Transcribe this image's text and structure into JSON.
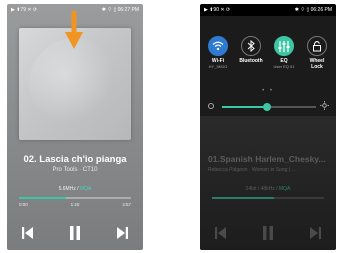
{
  "left_screen": {
    "status": {
      "left": "▶ ⬆79 ✕ ⟳",
      "right": "✱ ⌔ ▯ 06:27 PM"
    },
    "track_title": "02. Lascia ch'io pianga",
    "track_subtitle": "Pro Tools · CT10",
    "format": "5.6MHz / ",
    "format_highlight": "MQA",
    "elapsed": "0:00",
    "mid": "1:20",
    "total": "3:57",
    "progress": 0.42,
    "icons": {
      "arrow": "down-arrow-icon",
      "prev": "skip-previous-icon",
      "play": "pause-icon",
      "next": "skip-next-icon"
    },
    "accent": "#3dc6a4",
    "arrow_color": "#f29422"
  },
  "right_screen": {
    "status": {
      "left": "▶ ⬆90 ✕ ⟳",
      "right": "✱ ⌔ ▯ 06:26 PM"
    },
    "quick_settings": [
      {
        "label": "Wi-Fi",
        "sub": "HY_5KDG",
        "active": true,
        "icon": "wifi-icon",
        "color": "#2f7ad1"
      },
      {
        "label": "Bluetooth",
        "sub": "",
        "active": false,
        "icon": "bluetooth-icon"
      },
      {
        "label": "EQ",
        "sub": "User EQ 01",
        "active": true,
        "icon": "equalizer-icon",
        "color": "#3dc6a4"
      },
      {
        "label": "Wheel Lock",
        "sub": "",
        "active": false,
        "icon": "lock-icon"
      }
    ],
    "page_dots": "• •",
    "brightness": 0.48,
    "track_title": "01.Spanish Harlem_Chesky...",
    "track_subtitle": "Rebecca Pidgeon · Women in Song | ...",
    "format": "24bit / 48kHz / ",
    "format_highlight": "MQA",
    "progress": 0.55
  }
}
